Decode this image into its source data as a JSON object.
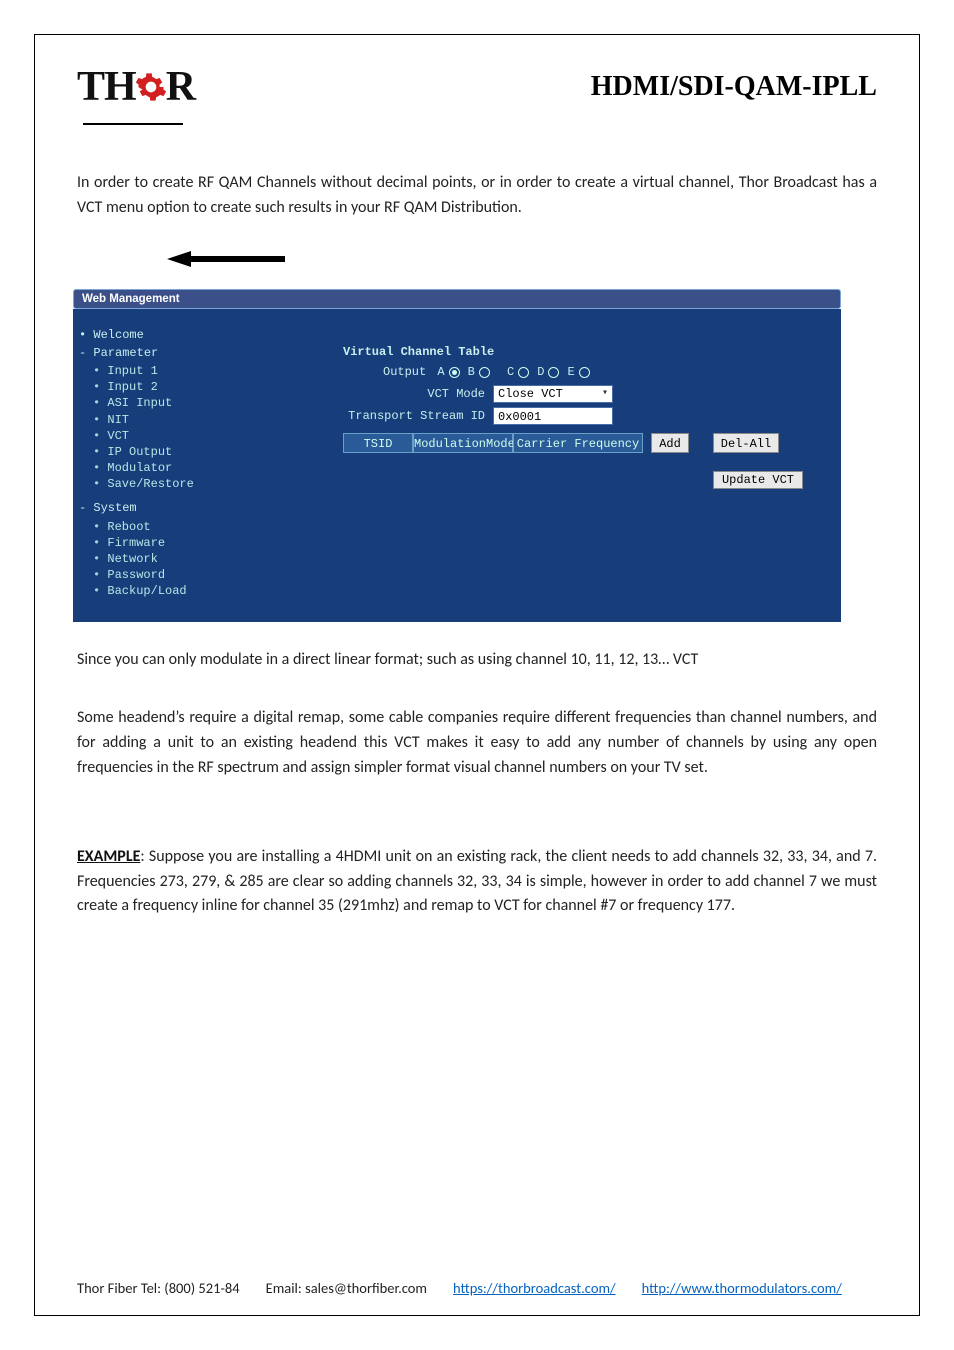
{
  "header": {
    "logo_left": "TH",
    "logo_right": "R",
    "doc_title": "HDMI/SDI-QAM-IPLL"
  },
  "body": {
    "intro": "In order to create RF QAM Channels without decimal points, or in order to create a virtual channel, Thor Broadcast has a VCT menu option to create such results in your RF QAM Distribution.",
    "after_shot": "Since you can only modulate in a direct linear format; such as using channel 10, 11, 12, 13… VCT",
    "headend": "Some headend’s require a digital remap, some cable companies require different frequencies than channel numbers, and for adding a unit to an existing headend this VCT makes it easy to add any number of channels by using any open frequencies in the RF spectrum and assign simpler format visual channel numbers on your TV set.",
    "example_label": "EXAMPLE",
    "example_text": ": Suppose you are installing a 4HDMI unit on an existing rack, the client needs to add channels 32, 33, 34, and 7. Frequencies 273, 279, & 285 are clear so adding channels 32, 33, 34 is simple, however in order to add channel 7 we must create a frequency inline for channel 35 (291mhz) and remap to VCT for channel #7 or frequency 177."
  },
  "webui": {
    "topbar": "Web Management",
    "side": {
      "welcome": "Welcome",
      "parameter": "Parameter",
      "parameter_items": [
        "Input 1",
        "Input 2",
        "ASI Input",
        "NIT",
        "VCT",
        "IP Output",
        "Modulator",
        "Save/Restore"
      ],
      "system": "System",
      "system_items": [
        "Reboot",
        "Firmware",
        "Network",
        "Password",
        "Backup/Load"
      ]
    },
    "panel": {
      "title": "Virtual Channel Table",
      "output_label": "Output",
      "outputs": [
        "A",
        "B",
        "C",
        "D",
        "E"
      ],
      "output_selected": "A",
      "vct_mode_label": "VCT Mode",
      "vct_mode_value": "Close VCT",
      "tsid_label": "Transport Stream ID",
      "tsid_value": "0x0001",
      "cols": [
        "TSID",
        "ModulationMode",
        "Carrier Frequency"
      ],
      "add_btn": "Add",
      "delall_btn": "Del-All",
      "update_btn": "Update VCT"
    }
  },
  "footer": {
    "tel": "Thor Fiber Tel: (800) 521-84",
    "email": "Email: sales@thorfiber.com",
    "link1": "https://thorbroadcast.com/",
    "link2": "http://www.thormodulators.com/"
  }
}
